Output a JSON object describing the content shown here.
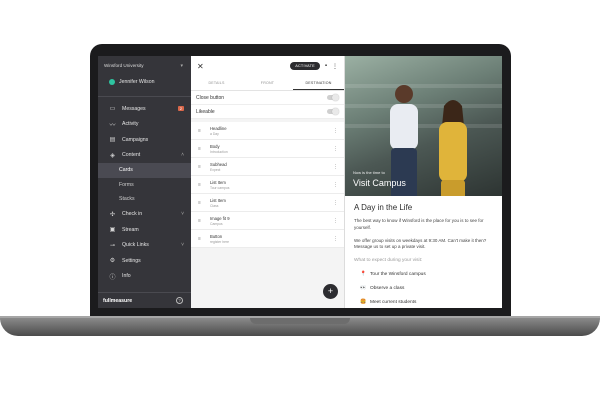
{
  "sidebar": {
    "org_name": "Winsford University",
    "user_name": "Jennifer Wilson",
    "items": [
      {
        "label": "Messages",
        "icon": "inbox-icon",
        "badge": "2"
      },
      {
        "label": "Activity",
        "icon": "activity-icon"
      },
      {
        "label": "Campaigns",
        "icon": "campaigns-icon"
      },
      {
        "label": "Content",
        "icon": "layers-icon"
      },
      {
        "label": "Cards",
        "icon": ""
      },
      {
        "label": "Forms",
        "icon": ""
      },
      {
        "label": "Stacks",
        "icon": ""
      },
      {
        "label": "Check in",
        "icon": "checkin-icon"
      },
      {
        "label": "Stream",
        "icon": "stream-icon"
      },
      {
        "label": "Quick Links",
        "icon": "link-icon"
      },
      {
        "label": "Settings",
        "icon": "gear-icon"
      },
      {
        "label": "Info",
        "icon": "info-icon"
      }
    ],
    "footer_logo": "fullmeasure",
    "help": "?"
  },
  "editor": {
    "close": "✕",
    "activate_label": "ACTIVATE",
    "tabs": [
      "DETAILS",
      "FRONT",
      "DESTINATION"
    ],
    "active_tab": "DESTINATION",
    "toggles": [
      {
        "label": "Close button",
        "on": false
      },
      {
        "label": "Likeable",
        "on": false
      }
    ],
    "components": [
      {
        "title": "Headline",
        "sub": "a Day"
      },
      {
        "title": "Body",
        "sub": "Introduction"
      },
      {
        "title": "Subhead",
        "sub": "Expect"
      },
      {
        "title": "List Item",
        "sub": "Tour campus"
      },
      {
        "title": "List Item",
        "sub": "Class"
      },
      {
        "title": "Image fit 9",
        "sub": "Campus"
      },
      {
        "title": "Button",
        "sub": "register here"
      }
    ],
    "fab": "+"
  },
  "preview": {
    "kicker": "Now is the time to",
    "hero_title": "Visit Campus",
    "heading": "A Day in the Life",
    "p1": "The best way to know if Winsford is the place for you is to see for yourself.",
    "p2": "We offer group visits on weekdays at 9:30 AM. Can't make it then? Message us to set up a private visit.",
    "question": "What to expect during your visit:",
    "list": [
      {
        "emoji": "📍",
        "text": "Tour the Winsford campus"
      },
      {
        "emoji": "👀",
        "text": "Observe a class"
      },
      {
        "emoji": "🍔",
        "text": "Meet current students"
      }
    ]
  },
  "colors": {
    "sidebar_bg": "#35353a",
    "accent_badge": "#d9674a",
    "avatar": "#2ec4a0"
  }
}
